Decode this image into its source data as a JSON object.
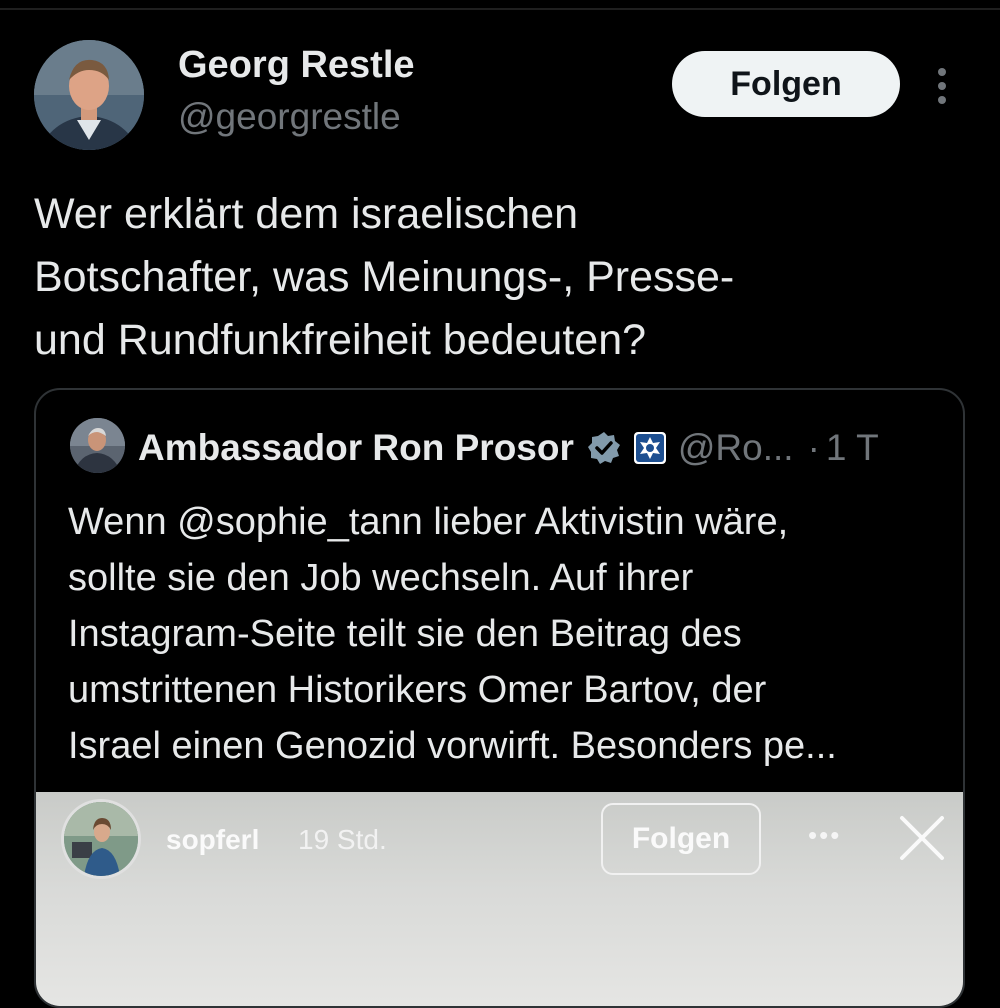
{
  "tweet": {
    "author_name": "Georg Restle",
    "author_handle": "@georgrestle",
    "follow_label": "Folgen",
    "text_lines": [
      "Wer erklärt dem israelischen",
      "Botschafter, was Meinungs-, Presse-",
      "und Rundfunkfreiheit bedeuten?"
    ]
  },
  "quote": {
    "author_name": "Ambassador Ron Prosor",
    "author_handle": "@Ro...",
    "separator": "·",
    "time": "1 T",
    "text_lines": [
      "Wenn @sophie_tann lieber Aktivistin wäre,",
      "sollte sie den Job wechseln. Auf ihrer",
      "Instagram-Seite teilt sie den Beitrag des",
      "umstrittenen Historikers Omer Bartov, der",
      "Israel einen Genozid vorwirft. Besonders pe..."
    ],
    "media": {
      "username": "sopferl",
      "time": "19 Std.",
      "follow_label": "Folgen",
      "more_label": "•••"
    }
  },
  "colors": {
    "background": "#000000",
    "text_primary": "#e7e9ea",
    "text_secondary": "#71767b",
    "verified": "#829aab",
    "follow_bg": "#eff3f4"
  }
}
